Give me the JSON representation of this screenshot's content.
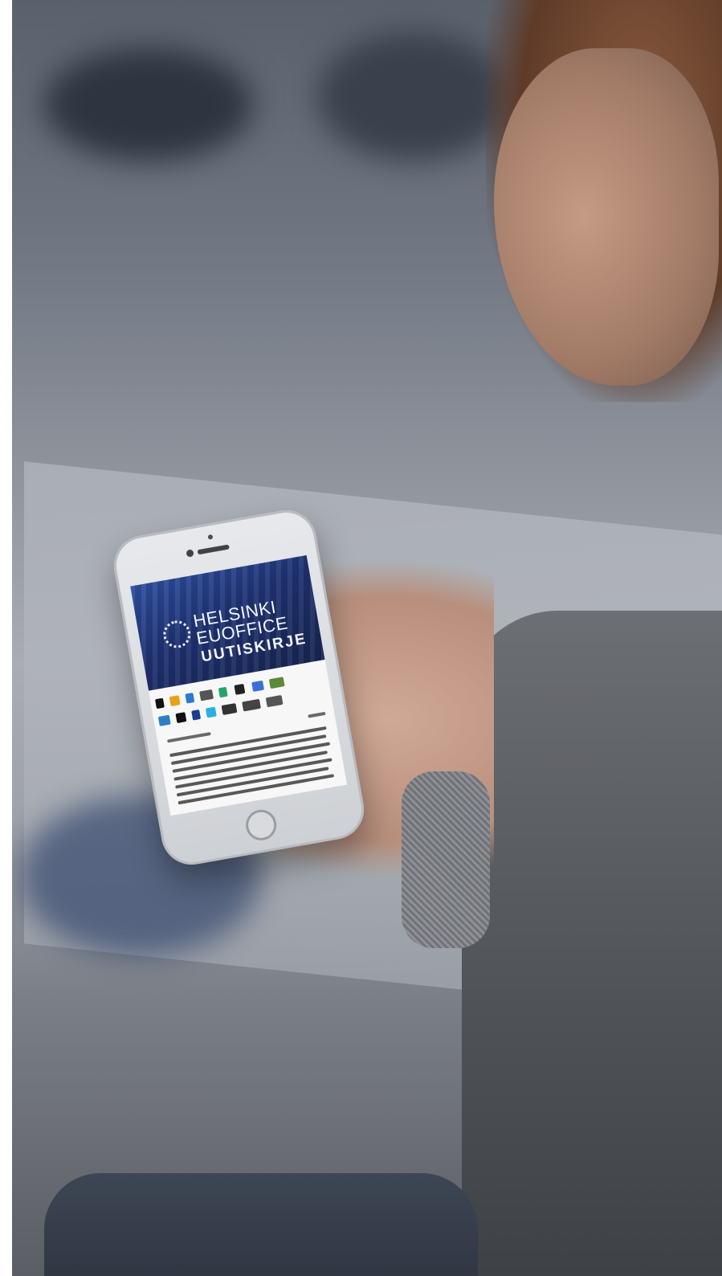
{
  "image": {
    "phone_screen": {
      "header": {
        "line1": "HELSINKI",
        "line2": "EUOFFICE",
        "line3": "UUTISKIRJE"
      }
    },
    "colors": {
      "hero_blue": "#1f3272",
      "screen_bg": "#f7f7f7",
      "phone_body": "#dcdfe2"
    }
  }
}
